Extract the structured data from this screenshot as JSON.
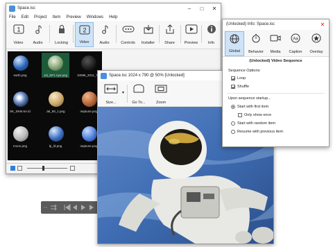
{
  "colors": {
    "accent": "#1e6fc4",
    "selection": "#cfe3f7",
    "close_red": "#e81123",
    "dark_overlay": "#5b5b5b"
  },
  "main_window": {
    "title": "Space.isc",
    "menu": [
      "File",
      "Edit",
      "Project",
      "Item",
      "Preview",
      "Windows",
      "Help"
    ],
    "toolbar": [
      {
        "label": "Video",
        "icon": "number-one-icon"
      },
      {
        "label": "Audio",
        "icon": "music-note-icon"
      },
      {
        "label": "Locking",
        "icon": "lock-icon"
      },
      {
        "label": "Video",
        "icon": "number-two-icon",
        "selected": true
      },
      {
        "label": "Audio",
        "icon": "music-note-icon"
      },
      {
        "label": "Controls",
        "icon": "controls-icon"
      },
      {
        "label": "Installer",
        "icon": "installer-icon"
      },
      {
        "label": "Share",
        "icon": "share-icon"
      },
      {
        "label": "Preview",
        "icon": "preview-play-icon"
      },
      {
        "label": "Info",
        "icon": "info-icon"
      }
    ],
    "thumbnails": [
      {
        "caption": "earth.png",
        "color": "#2a63b8"
      },
      {
        "caption": "eve_150_jpn5.png",
        "color": "#7a9b6a"
      },
      {
        "caption": "10086_2011_Transit_960x640_200",
        "color": "#222222"
      },
      {
        "caption": "5c_SK5MOA...",
        "color": "#444444"
      },
      {
        "caption": "Jal_59_T...png",
        "color": "#c9a76b"
      },
      {
        "caption": "mars.png",
        "color": "#b5653a"
      },
      {
        "caption": "moon.png",
        "color": "#b8b8b8"
      },
      {
        "caption": "moon.png",
        "color": "#3a6bbf"
      },
      {
        "caption": "neptune.png",
        "color": "#4f7fdd"
      }
    ],
    "grid_captions": [
      "earth.png",
      "Jal_SP1 nye.png",
      "mars.png",
      "SK_SKM.6A.ld.png",
      "Jal_59_1.png",
      "neptune.png",
      "moon.png",
      "lp_ld.png",
      "neptune.png"
    ]
  },
  "player_controls": {
    "icons": [
      "shuffle-icon",
      "skip-back-icon",
      "prev-icon",
      "play-icon",
      "next-icon",
      "skip-forward-icon",
      "fullscreen-icon"
    ]
  },
  "preview_window": {
    "title": "Space.isc  1024 x 790 @ 50% [Unlocked]",
    "tools": [
      {
        "label": "Size...",
        "icon": "size-icon"
      },
      {
        "label": "Go To...",
        "icon": "goto-icon"
      },
      {
        "label": "Zoom",
        "icon": "zoom-icon"
      }
    ]
  },
  "info_window": {
    "title": "(Unlocked) Info: Space.isc",
    "tabs": [
      {
        "label": "Global",
        "icon": "globe-icon",
        "selected": true
      },
      {
        "label": "Behavior",
        "icon": "stopwatch-icon"
      },
      {
        "label": "Media",
        "icon": "camera-icon"
      },
      {
        "label": "Caption",
        "icon": "caption-icon"
      },
      {
        "label": "Overlay",
        "icon": "overlay-icon"
      }
    ],
    "heading": "(Unlocked) Video Sequence",
    "sequence_options_label": "Sequence Options:",
    "loop_label": "Loop",
    "loop_checked": true,
    "shuffle_label": "Shuffle",
    "shuffle_checked": true,
    "startup_label": "Upon sequence startup...",
    "radio_options": [
      {
        "label": "Start with first item",
        "checked": true
      },
      {
        "label": "Start with random item",
        "checked": false
      },
      {
        "label": "Resume with previous item",
        "checked": false
      }
    ],
    "only_show_once_label": "Only show once",
    "only_show_once_checked": false
  }
}
